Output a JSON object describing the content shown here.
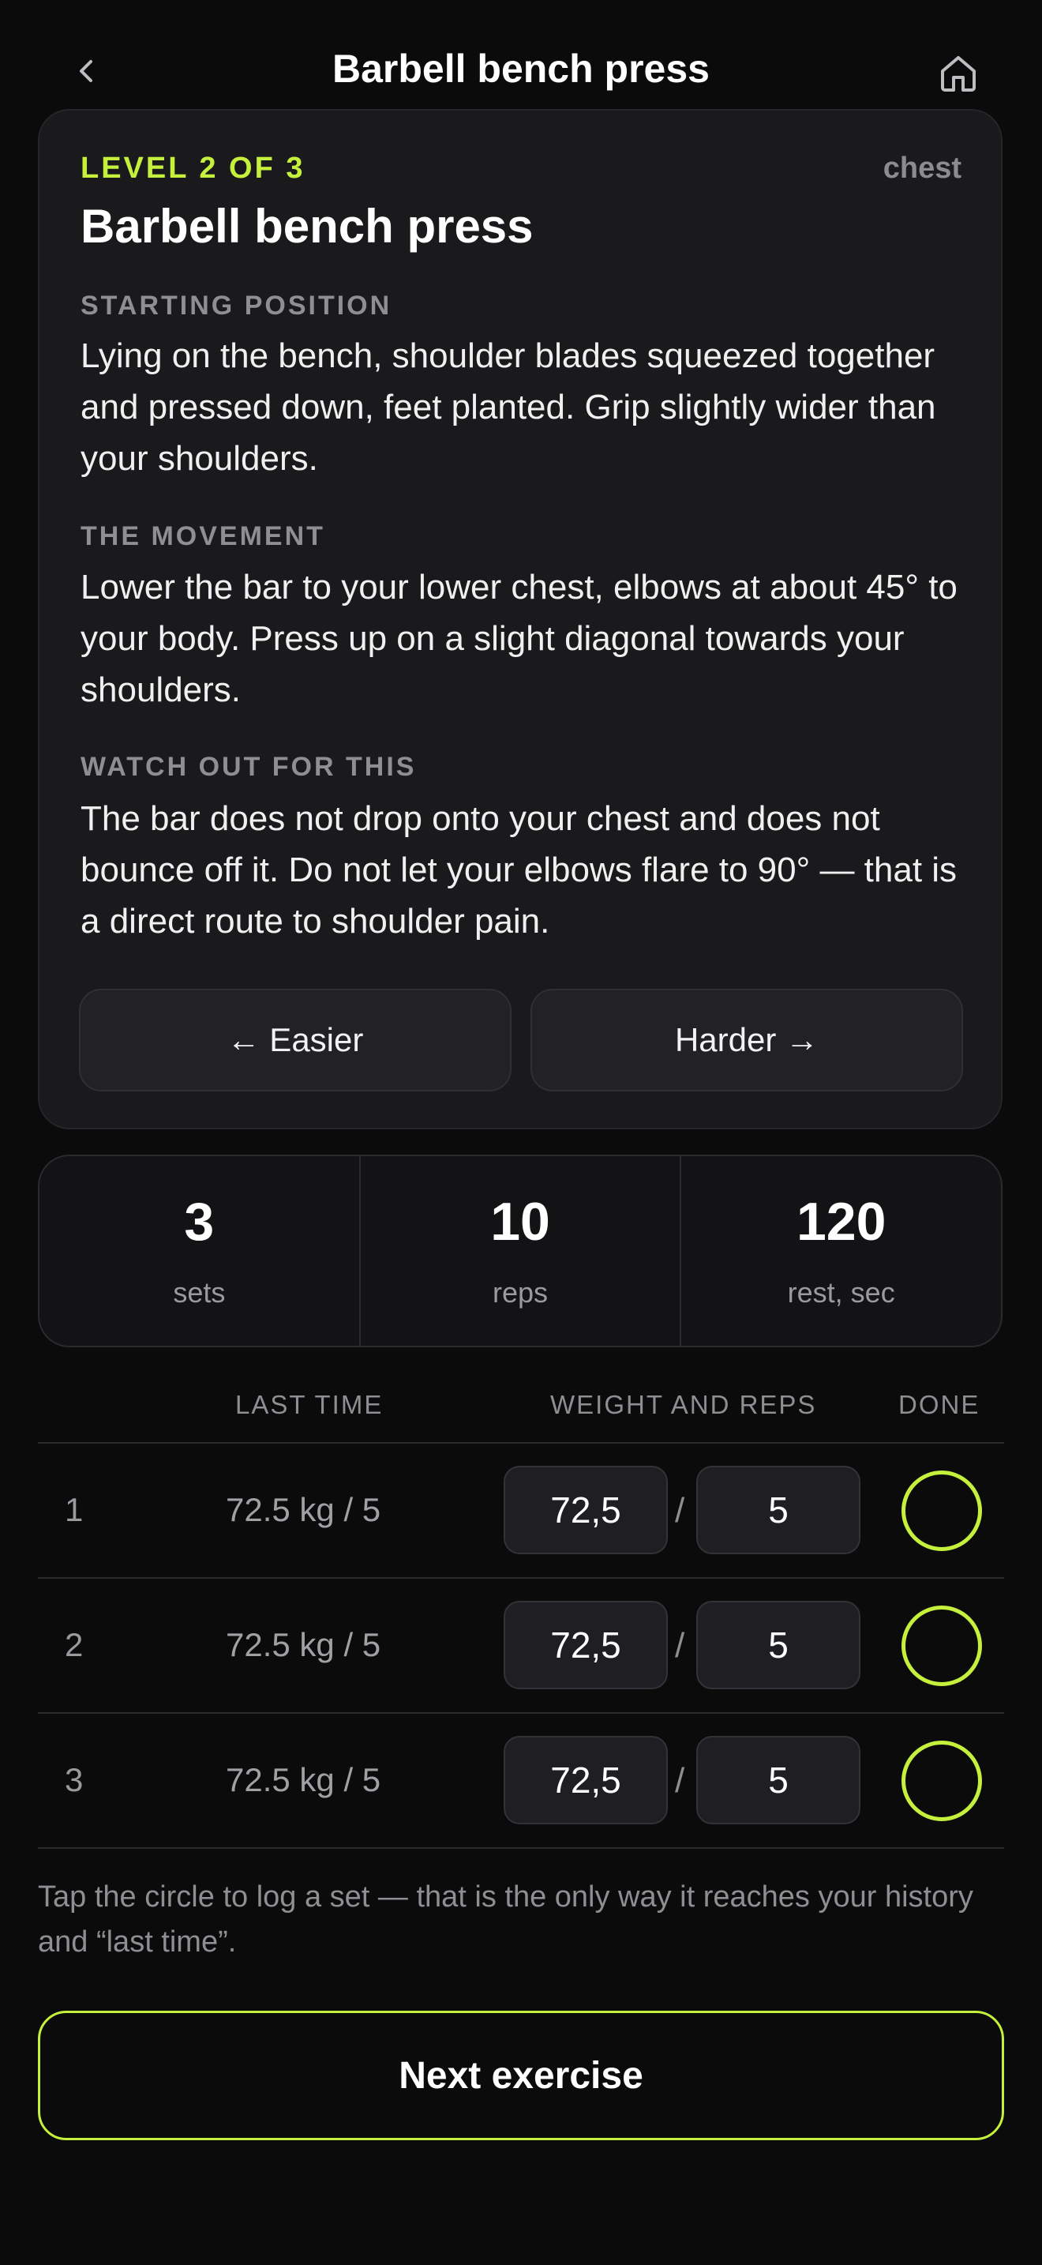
{
  "header": {
    "title": "Barbell bench press",
    "back_icon": "chevron-left-icon",
    "home_icon": "home-icon"
  },
  "exercise": {
    "level": "LEVEL 2 OF 3",
    "muscle_group": "chest",
    "name": "Barbell bench press",
    "sections": [
      {
        "heading": "STARTING POSITION",
        "text": "Lying on the bench, shoulder blades squeezed together and pressed down, feet planted. Grip slightly wider than your shoulders."
      },
      {
        "heading": "THE MOVEMENT",
        "text": "Lower the bar to your lower chest, elbows at about 45° to your body. Press up on a slight diagonal towards your shoulders."
      },
      {
        "heading": "WATCH OUT FOR THIS",
        "text": "The bar does not drop onto your chest and does not bounce off it. Do not let your elbows flare to 90° — that is a direct route to shoulder pain."
      }
    ],
    "easier_label": "← Easier",
    "harder_label": "Harder →"
  },
  "stats": [
    {
      "value": "3",
      "label": "sets"
    },
    {
      "value": "10",
      "label": "reps"
    },
    {
      "value": "120",
      "label": "rest, sec"
    }
  ],
  "table": {
    "headers": {
      "last_time": "LAST TIME",
      "weight_reps": "WEIGHT AND REPS",
      "done": "DONE"
    },
    "rows": [
      {
        "num": "1",
        "last": "72.5 kg / 5",
        "weight": "72,5",
        "sep": "/",
        "reps": "5",
        "done": false
      },
      {
        "num": "2",
        "last": "72.5 kg / 5",
        "weight": "72,5",
        "sep": "/",
        "reps": "5",
        "done": false
      },
      {
        "num": "3",
        "last": "72.5 kg / 5",
        "weight": "72,5",
        "sep": "/",
        "reps": "5",
        "done": false
      }
    ]
  },
  "hint": "Tap the circle to log a set — that is the only way it reaches your history and “last time”.",
  "next_label": "Next exercise",
  "colors": {
    "accent": "#c5f03c",
    "background": "#0b0b0c",
    "card": "#1a1a1d",
    "muted": "#8e8e93"
  }
}
